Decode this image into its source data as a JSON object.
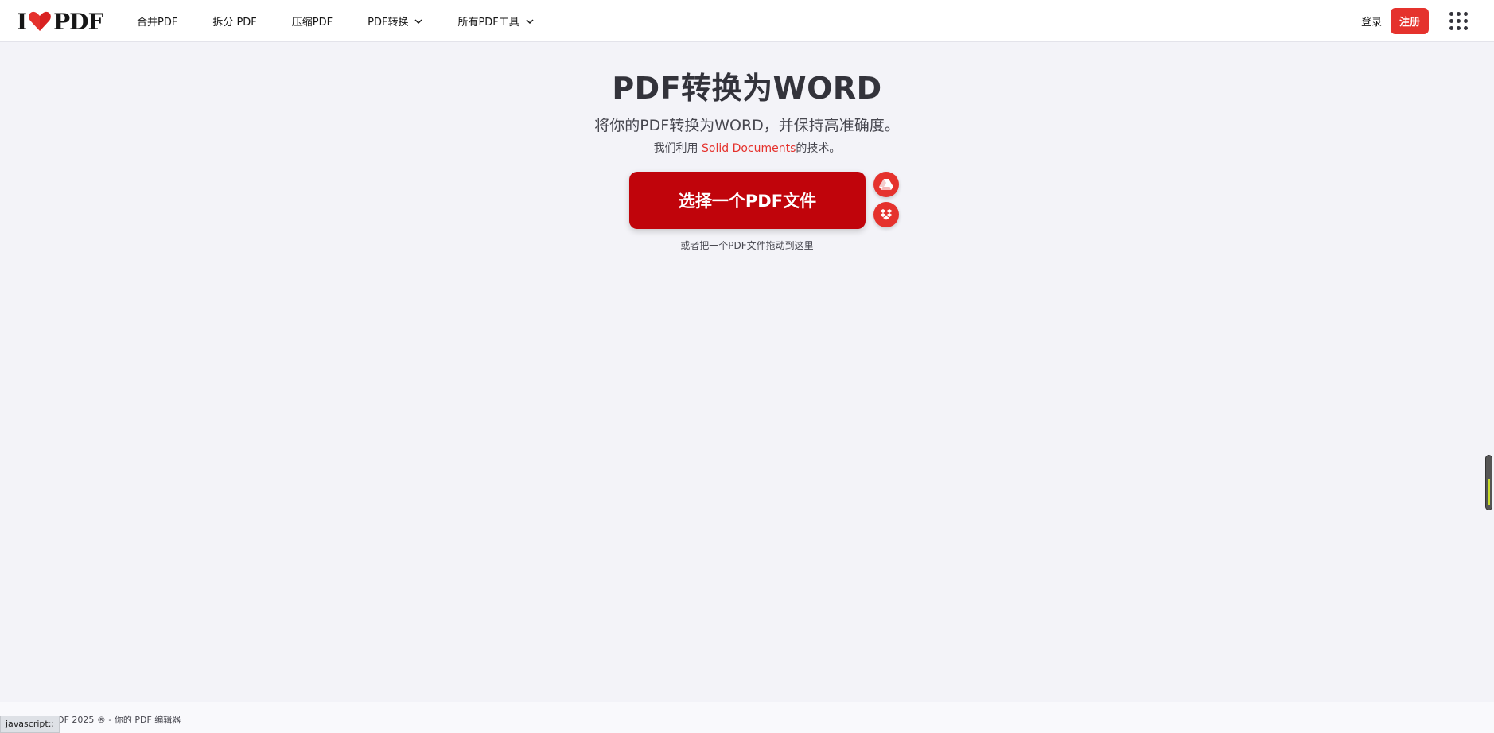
{
  "header": {
    "logo": {
      "left": "I",
      "right": "PDF"
    },
    "nav": [
      {
        "label": "合并PDF",
        "dropdown": false
      },
      {
        "label": "拆分 PDF",
        "dropdown": false
      },
      {
        "label": "压缩PDF",
        "dropdown": false
      },
      {
        "label": "PDF转换",
        "dropdown": true
      },
      {
        "label": "所有PDF工具",
        "dropdown": true
      }
    ],
    "login": "登录",
    "signup": "注册"
  },
  "hero": {
    "title": "PDF转换为WORD",
    "subtitle": "将你的PDF转换为WORD，并保持高准确度。",
    "tech_prefix": "我们利用 ",
    "tech_link": "Solid Documents",
    "tech_suffix": "的技术。"
  },
  "upload": {
    "select_label": "选择一个PDF文件",
    "drop_hint": "或者把一个PDF文件拖动到这里",
    "gdrive_icon": "google-drive-icon",
    "dropbox_icon": "dropbox-icon"
  },
  "footer": {
    "copyright": "© iLovePDF 2025 ® - 你的 PDF 编辑器"
  },
  "status_tooltip": "javascript:;",
  "colors": {
    "brand_red": "#e5322d",
    "button_red": "#c0040b",
    "background": "#f3f3f8"
  }
}
